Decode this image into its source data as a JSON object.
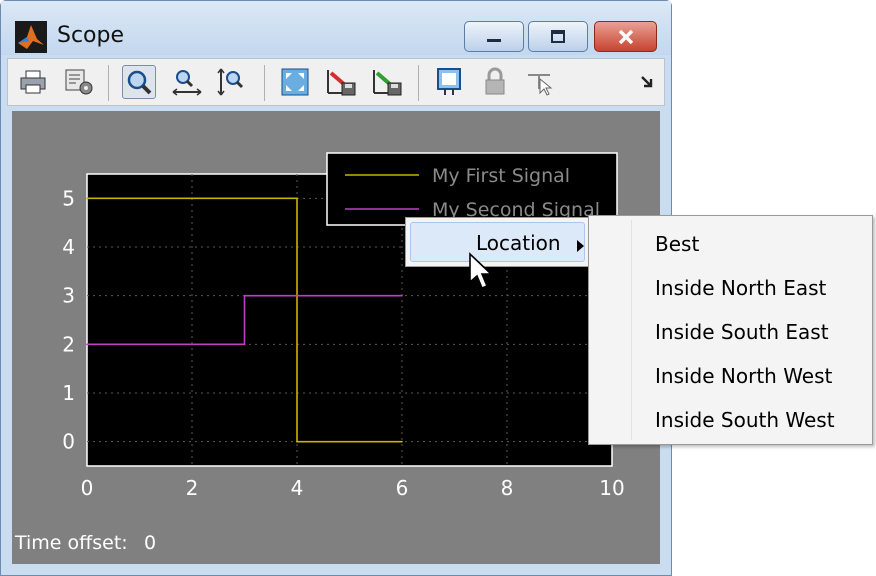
{
  "window": {
    "title": "Scope"
  },
  "toolbar": {
    "buttons": [
      {
        "name": "print-icon"
      },
      {
        "name": "parameters-icon"
      },
      {
        "name": "zoom-icon",
        "active": true
      },
      {
        "name": "zoom-x-icon"
      },
      {
        "name": "zoom-y-icon"
      },
      {
        "name": "autoscale-icon"
      },
      {
        "name": "save-axes-settings-icon"
      },
      {
        "name": "restore-axes-settings-icon"
      },
      {
        "name": "floating-scope-icon"
      },
      {
        "name": "lock-axes-icon"
      },
      {
        "name": "signal-selection-icon"
      }
    ]
  },
  "legend": {
    "entries": [
      "My First Signal",
      "My Second Signal"
    ]
  },
  "context_menu": {
    "item": "Location",
    "submenu": [
      "Best",
      "Inside North East",
      "Inside South East",
      "Inside North West",
      "Inside South West"
    ]
  },
  "status": {
    "time_offset_label": "Time offset:",
    "time_offset_value": "0"
  },
  "colors": {
    "plot_bg": "#000000",
    "frame_bg": "#808080",
    "signal1": "#c8b400",
    "signal2": "#c040c0"
  },
  "chart_data": {
    "type": "line",
    "xlim": [
      0,
      10
    ],
    "ylim": [
      -0.5,
      5.5
    ],
    "x_ticks": [
      0,
      2,
      4,
      6,
      8,
      10
    ],
    "y_ticks": [
      0,
      1,
      2,
      3,
      4,
      5
    ],
    "grid": true,
    "legend_position": "top-right",
    "series": [
      {
        "name": "My First Signal",
        "color": "#c8b400",
        "step": true,
        "x": [
          0,
          4,
          4,
          6
        ],
        "y": [
          5,
          5,
          0,
          0
        ]
      },
      {
        "name": "My Second Signal",
        "color": "#c040c0",
        "step": true,
        "x": [
          0,
          3,
          3,
          6
        ],
        "y": [
          2,
          2,
          3,
          3
        ]
      }
    ]
  }
}
